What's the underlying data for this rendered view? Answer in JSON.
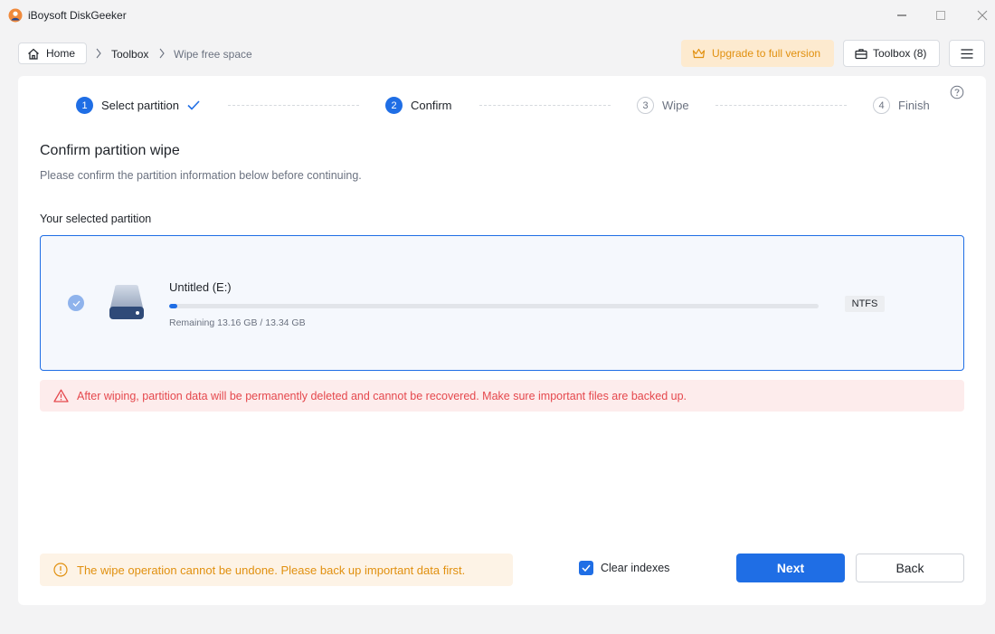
{
  "window": {
    "title": "iBoysoft DiskGeeker",
    "icons": [
      "app-logo-icon",
      "minimize-icon",
      "maximize-icon",
      "close-icon"
    ]
  },
  "nav": {
    "home_label": "Home",
    "breadcrumb": [
      "Toolbox",
      "Wipe free space"
    ],
    "upgrade_label": "Upgrade to full version",
    "toolbox_label": "Toolbox (8)"
  },
  "stepper": [
    {
      "num": "1",
      "label": "Select partition",
      "state": "done"
    },
    {
      "num": "2",
      "label": "Confirm",
      "state": "active"
    },
    {
      "num": "3",
      "label": "Wipe",
      "state": "idle"
    },
    {
      "num": "4",
      "label": "Finish",
      "state": "idle"
    }
  ],
  "content": {
    "title": "Confirm partition wipe",
    "subtitle": "Please confirm the partition information below before continuing.",
    "section_label": "Your selected partition"
  },
  "partition": {
    "name": "Untitled (E:)",
    "remaining": "Remaining 13.16 GB / 13.34 GB",
    "used_fraction": 0.013,
    "filesystem": "NTFS"
  },
  "warning": {
    "text": "After wiping, partition data will be permanently deleted and cannot be recovered. Make sure important files are backed up."
  },
  "footer": {
    "note": "The wipe operation cannot be undone. Please back up important data first.",
    "clear_indexes_label": "Clear indexes",
    "clear_indexes_checked": true,
    "next_label": "Next",
    "back_label": "Back"
  },
  "colors": {
    "accent": "#1f6ee5",
    "warning_red": "#e5484d",
    "warning_orange": "#e1900f"
  }
}
